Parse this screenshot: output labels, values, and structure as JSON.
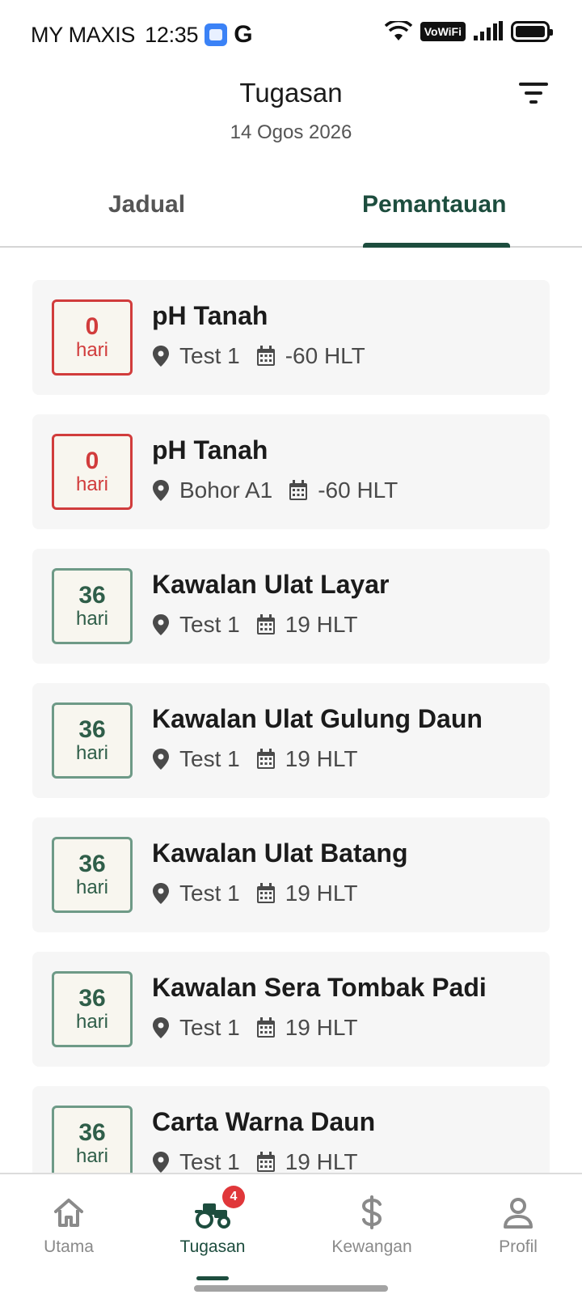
{
  "status_bar": {
    "carrier": "MY MAXIS",
    "time": "12:35",
    "g_label": "G",
    "vowifi": "VoWiFi"
  },
  "header": {
    "title": "Tugasan",
    "date": "14 Ogos 2026"
  },
  "tabs": [
    {
      "label": "Jadual",
      "active": false
    },
    {
      "label": "Pemantauan",
      "active": true
    }
  ],
  "tasks": [
    {
      "days": "0",
      "unit": "hari",
      "status": "overdue",
      "title": "pH Tanah",
      "location": "Test 1",
      "hlt": "-60 HLT"
    },
    {
      "days": "0",
      "unit": "hari",
      "status": "overdue",
      "title": "pH Tanah",
      "location": "Bohor A1",
      "hlt": "-60 HLT"
    },
    {
      "days": "36",
      "unit": "hari",
      "status": "upcoming",
      "title": "Kawalan Ulat Layar",
      "location": "Test 1",
      "hlt": "19 HLT"
    },
    {
      "days": "36",
      "unit": "hari",
      "status": "upcoming",
      "title": "Kawalan Ulat Gulung Daun",
      "location": "Test 1",
      "hlt": "19 HLT"
    },
    {
      "days": "36",
      "unit": "hari",
      "status": "upcoming",
      "title": "Kawalan Ulat Batang",
      "location": "Test 1",
      "hlt": "19 HLT"
    },
    {
      "days": "36",
      "unit": "hari",
      "status": "upcoming",
      "title": "Kawalan Sera Tombak Padi",
      "location": "Test 1",
      "hlt": "19 HLT"
    },
    {
      "days": "36",
      "unit": "hari",
      "status": "upcoming",
      "title": "Carta Warna Daun",
      "location": "Test 1",
      "hlt": "19 HLT"
    }
  ],
  "bottom_nav": {
    "items": [
      {
        "label": "Utama",
        "icon": "home-icon",
        "active": false
      },
      {
        "label": "Tugasan",
        "icon": "tractor-icon",
        "active": true,
        "badge": "4"
      },
      {
        "label": "Kewangan",
        "icon": "dollar-icon",
        "active": false
      },
      {
        "label": "Profil",
        "icon": "person-icon",
        "active": false
      }
    ]
  },
  "colors": {
    "accent": "#1d4d3e",
    "overdue": "#d13c3c",
    "upcoming_border": "#6e9a87",
    "badge_bg": "#e0373a"
  }
}
